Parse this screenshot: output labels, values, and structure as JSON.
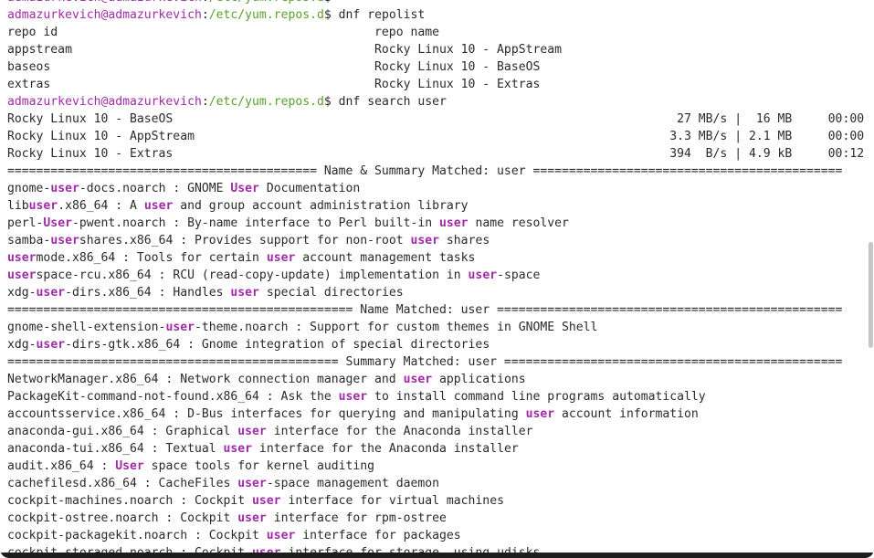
{
  "terminal": {
    "lines": [
      [
        {
          "t": "admazurkevich@admazurkevich",
          "c": "purple"
        },
        {
          "t": ":",
          "c": ""
        },
        {
          "t": "/etc/yum.repos.d",
          "c": "green"
        },
        {
          "t": "$",
          "c": ""
        }
      ],
      [
        {
          "t": "admazurkevich@admazurkevich",
          "c": "purple"
        },
        {
          "t": ":",
          "c": ""
        },
        {
          "t": "/etc/yum.repos.d",
          "c": "green"
        },
        {
          "t": "$ dnf repolist",
          "c": ""
        }
      ],
      [
        {
          "t": "repo id                                            repo name",
          "c": ""
        }
      ],
      [
        {
          "t": "appstream                                          Rocky Linux 10 - AppStream",
          "c": ""
        }
      ],
      [
        {
          "t": "baseos                                             Rocky Linux 10 - BaseOS",
          "c": ""
        }
      ],
      [
        {
          "t": "extras                                             Rocky Linux 10 - Extras",
          "c": ""
        }
      ],
      [
        {
          "t": "admazurkevich@admazurkevich",
          "c": "purple"
        },
        {
          "t": ":",
          "c": ""
        },
        {
          "t": "/etc/yum.repos.d",
          "c": "green"
        },
        {
          "t": "$ dnf search user",
          "c": ""
        }
      ],
      [
        {
          "t": "Rocky Linux 10 - BaseOS                                                                      27 MB/s |  16 MB     00:00",
          "c": ""
        }
      ],
      [
        {
          "t": "Rocky Linux 10 - AppStream                                                                  3.3 MB/s | 2.1 MB     00:00",
          "c": ""
        }
      ],
      [
        {
          "t": "Rocky Linux 10 - Extras                                                                     394  B/s | 4.9 kB     00:12",
          "c": ""
        }
      ],
      [
        {
          "t": "=========================================== Name & Summary Matched: user ===========================================",
          "c": ""
        }
      ],
      [
        {
          "t": "gnome-",
          "c": ""
        },
        {
          "t": "user",
          "c": "hl"
        },
        {
          "t": "-docs.noarch : GNOME ",
          "c": ""
        },
        {
          "t": "User",
          "c": "hl"
        },
        {
          "t": " Documentation",
          "c": ""
        }
      ],
      [
        {
          "t": "lib",
          "c": ""
        },
        {
          "t": "user",
          "c": "hl"
        },
        {
          "t": ".x86_64 : A ",
          "c": ""
        },
        {
          "t": "user",
          "c": "hl"
        },
        {
          "t": " and group account administration library",
          "c": ""
        }
      ],
      [
        {
          "t": "perl-",
          "c": ""
        },
        {
          "t": "User",
          "c": "hl"
        },
        {
          "t": "-pwent.noarch : By-name interface to Perl built-in ",
          "c": ""
        },
        {
          "t": "user",
          "c": "hl"
        },
        {
          "t": " name resolver",
          "c": ""
        }
      ],
      [
        {
          "t": "samba-",
          "c": ""
        },
        {
          "t": "user",
          "c": "hl"
        },
        {
          "t": "shares.x86_64 : Provides support for non-root ",
          "c": ""
        },
        {
          "t": "user",
          "c": "hl"
        },
        {
          "t": " shares",
          "c": ""
        }
      ],
      [
        {
          "t": "user",
          "c": "hl"
        },
        {
          "t": "mode.x86_64 : Tools for certain ",
          "c": ""
        },
        {
          "t": "user",
          "c": "hl"
        },
        {
          "t": " account management tasks",
          "c": ""
        }
      ],
      [
        {
          "t": "user",
          "c": "hl"
        },
        {
          "t": "space-rcu.x86_64 : RCU (read-copy-update) implementation in ",
          "c": ""
        },
        {
          "t": "user",
          "c": "hl"
        },
        {
          "t": "-space",
          "c": ""
        }
      ],
      [
        {
          "t": "xdg-",
          "c": ""
        },
        {
          "t": "user",
          "c": "hl"
        },
        {
          "t": "-dirs.x86_64 : Handles ",
          "c": ""
        },
        {
          "t": "user",
          "c": "hl"
        },
        {
          "t": " special directories",
          "c": ""
        }
      ],
      [
        {
          "t": "================================================ Name Matched: user ================================================",
          "c": ""
        }
      ],
      [
        {
          "t": "gnome-shell-extension-",
          "c": ""
        },
        {
          "t": "user",
          "c": "hl"
        },
        {
          "t": "-theme.noarch : Support for custom themes in GNOME Shell",
          "c": ""
        }
      ],
      [
        {
          "t": "xdg-",
          "c": ""
        },
        {
          "t": "user",
          "c": "hl"
        },
        {
          "t": "-dirs-gtk.x86_64 : Gnome integration of special directories",
          "c": ""
        }
      ],
      [
        {
          "t": "============================================== Summary Matched: user ===============================================",
          "c": ""
        }
      ],
      [
        {
          "t": "NetworkManager.x86_64 : Network connection manager and ",
          "c": ""
        },
        {
          "t": "user",
          "c": "hl"
        },
        {
          "t": " applications",
          "c": ""
        }
      ],
      [
        {
          "t": "PackageKit-command-not-found.x86_64 : Ask the ",
          "c": ""
        },
        {
          "t": "user",
          "c": "hl"
        },
        {
          "t": " to install command line programs automatically",
          "c": ""
        }
      ],
      [
        {
          "t": "accountsservice.x86_64 : D-Bus interfaces for querying and manipulating ",
          "c": ""
        },
        {
          "t": "user",
          "c": "hl"
        },
        {
          "t": " account information",
          "c": ""
        }
      ],
      [
        {
          "t": "anaconda-gui.x86_64 : Graphical ",
          "c": ""
        },
        {
          "t": "user",
          "c": "hl"
        },
        {
          "t": " interface for the Anaconda installer",
          "c": ""
        }
      ],
      [
        {
          "t": "anaconda-tui.x86_64 : Textual ",
          "c": ""
        },
        {
          "t": "user",
          "c": "hl"
        },
        {
          "t": " interface for the Anaconda installer",
          "c": ""
        }
      ],
      [
        {
          "t": "audit.x86_64 : ",
          "c": ""
        },
        {
          "t": "User",
          "c": "hl"
        },
        {
          "t": " space tools for kernel auditing",
          "c": ""
        }
      ],
      [
        {
          "t": "cachefilesd.x86_64 : CacheFiles ",
          "c": ""
        },
        {
          "t": "user",
          "c": "hl"
        },
        {
          "t": "-space management daemon",
          "c": ""
        }
      ],
      [
        {
          "t": "cockpit-machines.noarch : Cockpit ",
          "c": ""
        },
        {
          "t": "user",
          "c": "hl"
        },
        {
          "t": " interface for virtual machines",
          "c": ""
        }
      ],
      [
        {
          "t": "cockpit-ostree.noarch : Cockpit ",
          "c": ""
        },
        {
          "t": "user",
          "c": "hl"
        },
        {
          "t": " interface for rpm-ostree",
          "c": ""
        }
      ],
      [
        {
          "t": "cockpit-packagekit.noarch : Cockpit ",
          "c": ""
        },
        {
          "t": "user",
          "c": "hl"
        },
        {
          "t": " interface for packages",
          "c": ""
        }
      ],
      [
        {
          "t": "cockpit-storaged.noarch : Cockpit ",
          "c": ""
        },
        {
          "t": "user",
          "c": "hl"
        },
        {
          "t": " interface for storage, using udisks",
          "c": ""
        }
      ]
    ]
  },
  "colors": {
    "prompt_user": "#a12aa8",
    "prompt_path": "#5aa02c",
    "highlight": "#a12aa8",
    "text": "#2a2a2a",
    "background": "#ffffff"
  }
}
